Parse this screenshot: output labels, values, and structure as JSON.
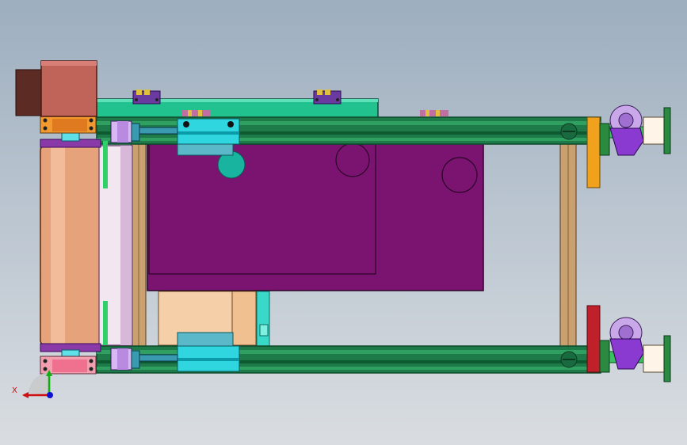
{
  "viewport": {
    "background_top": "#9daebf",
    "background_bottom": "#d9dde1"
  },
  "model": {
    "colors": {
      "frame_green": "#1f7a4a",
      "frame_green_dark": "#0d4a2a",
      "plate_purple": "#7b1470",
      "roller_copper": "#e6a27a",
      "roller_white": "#f2e6f0",
      "motor_brown": "#c0645a",
      "motor_dark": "#5b2b24",
      "teal": "#19b4a0",
      "cyan": "#2fd6e0",
      "wood": "#c9a070",
      "orange": "#f2a11c",
      "red": "#c0202a",
      "lavender": "#b47ae0",
      "peach": "#f5cfa8",
      "top_plate": "#21c28e"
    }
  },
  "triad": {
    "x_label": "X",
    "x_color": "#d01010",
    "y_color": "#10b010",
    "z_color": "#1010d0"
  }
}
